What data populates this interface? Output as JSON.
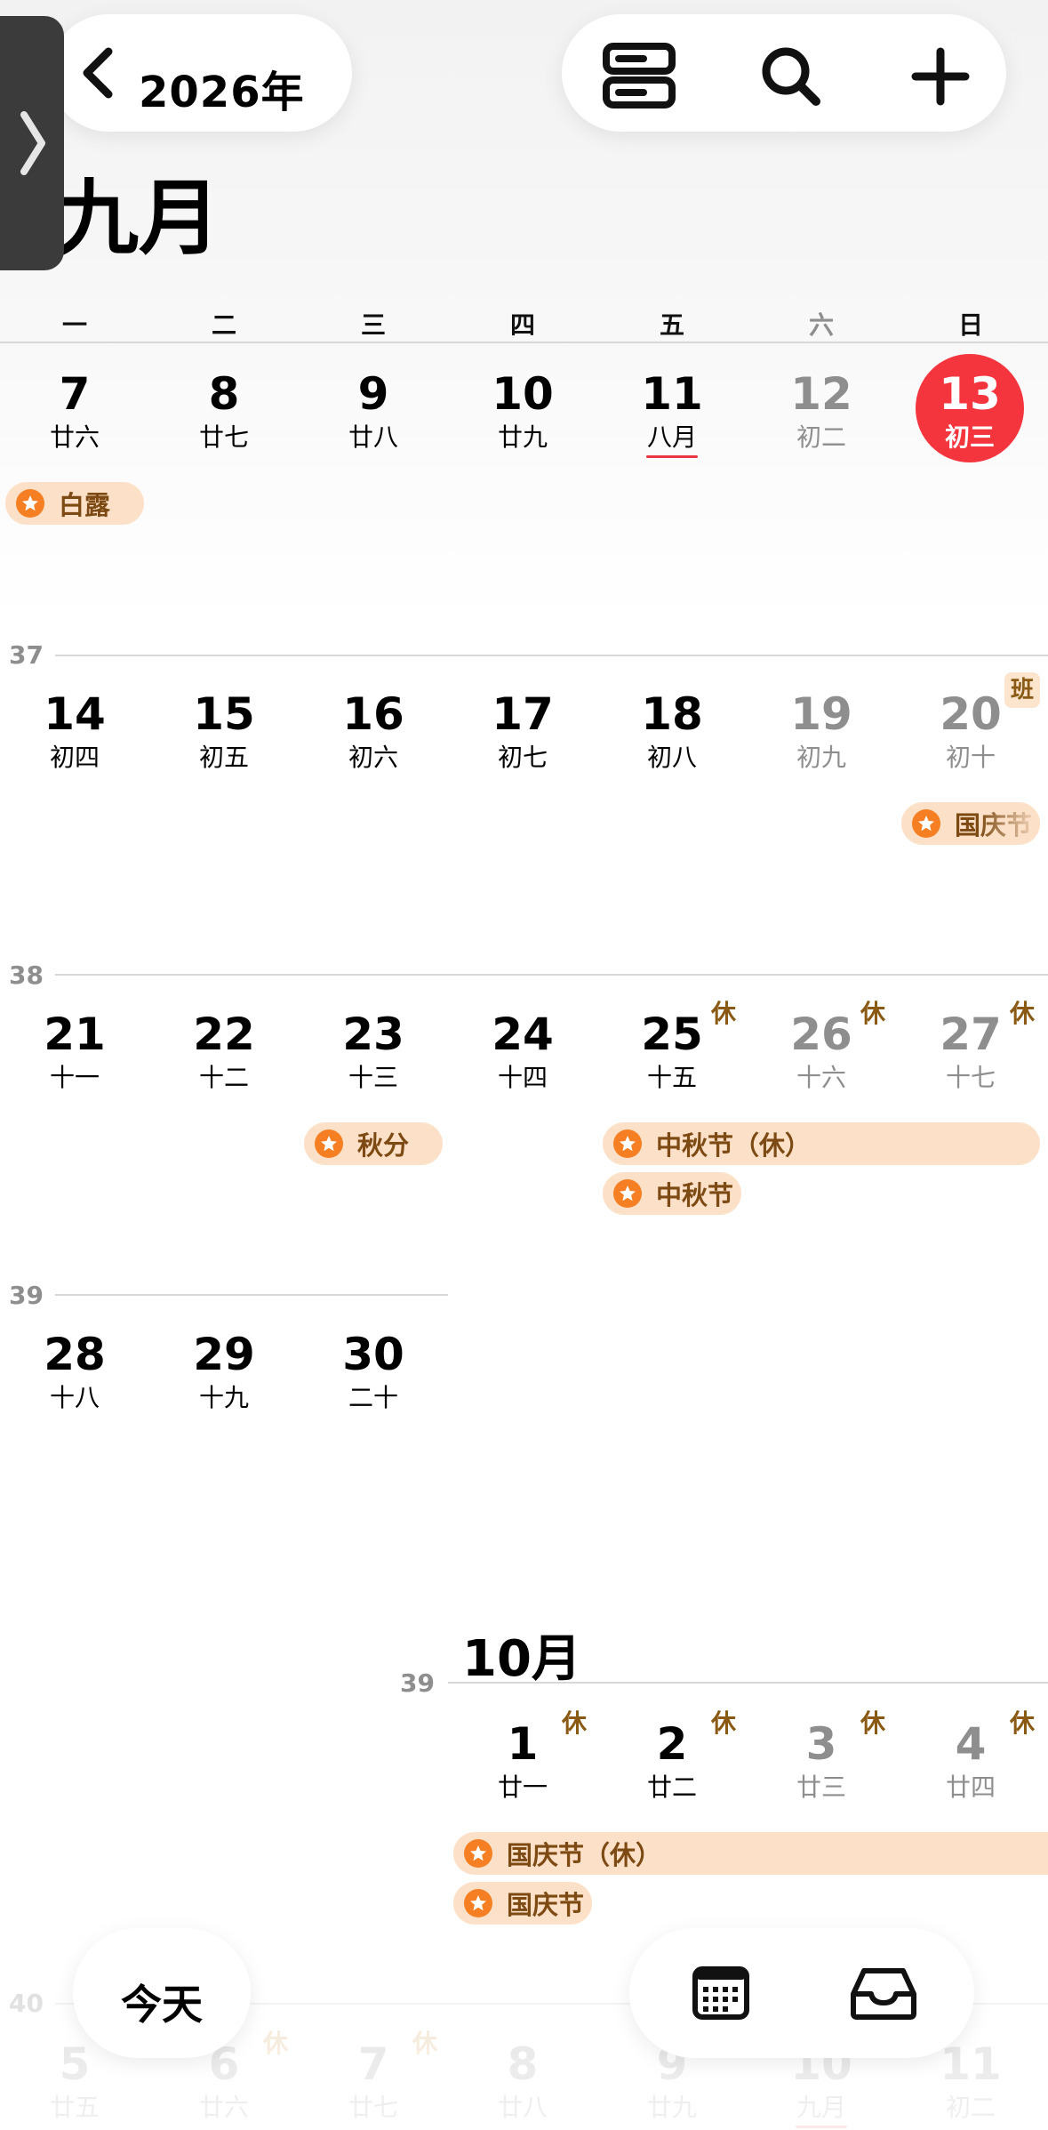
{
  "header": {
    "year": "2026年",
    "month_title": "九月"
  },
  "toolbar": {
    "icons": [
      "list-view-icon",
      "search-icon",
      "plus-icon"
    ]
  },
  "weekdays": [
    "一",
    "二",
    "三",
    "四",
    "五",
    "六",
    "日"
  ],
  "september": {
    "weeks": [
      {
        "days": [
          {
            "num": "7",
            "lunar": "廿六"
          },
          {
            "num": "8",
            "lunar": "廿七"
          },
          {
            "num": "9",
            "lunar": "廿八"
          },
          {
            "num": "10",
            "lunar": "廿九"
          },
          {
            "num": "11",
            "lunar": "八月"
          },
          {
            "num": "12",
            "lunar": "初二"
          },
          {
            "num": "13",
            "lunar": "初三"
          }
        ],
        "events": [
          {
            "label": "白露"
          }
        ]
      },
      {
        "week_number": "37",
        "days": [
          {
            "num": "14",
            "lunar": "初四"
          },
          {
            "num": "15",
            "lunar": "初五"
          },
          {
            "num": "16",
            "lunar": "初六"
          },
          {
            "num": "17",
            "lunar": "初七"
          },
          {
            "num": "18",
            "lunar": "初八"
          },
          {
            "num": "19",
            "lunar": "初九"
          },
          {
            "num": "20",
            "lunar": "初十",
            "badge": "班"
          }
        ],
        "events": [
          {
            "label": "国庆节"
          }
        ]
      },
      {
        "week_number": "38",
        "days": [
          {
            "num": "21",
            "lunar": "十一"
          },
          {
            "num": "22",
            "lunar": "十二"
          },
          {
            "num": "23",
            "lunar": "十三"
          },
          {
            "num": "24",
            "lunar": "十四"
          },
          {
            "num": "25",
            "lunar": "十五",
            "badge": "休"
          },
          {
            "num": "26",
            "lunar": "十六",
            "badge": "休"
          },
          {
            "num": "27",
            "lunar": "十七",
            "badge": "休"
          }
        ],
        "events": [
          {
            "label": "秋分"
          },
          {
            "label": "中秋节（休）"
          },
          {
            "label": "中秋节"
          }
        ]
      },
      {
        "week_number": "39",
        "days": [
          {
            "num": "28",
            "lunar": "十八"
          },
          {
            "num": "29",
            "lunar": "十九"
          },
          {
            "num": "30",
            "lunar": "二十"
          }
        ]
      }
    ]
  },
  "october": {
    "title": "10月",
    "weeks": [
      {
        "week_number": "39",
        "days": [
          {
            "num": "1",
            "lunar": "廿一",
            "badge": "休"
          },
          {
            "num": "2",
            "lunar": "廿二",
            "badge": "休"
          },
          {
            "num": "3",
            "lunar": "廿三",
            "badge": "休"
          },
          {
            "num": "4",
            "lunar": "廿四",
            "badge": "休"
          }
        ],
        "events": [
          {
            "label": "国庆节（休）"
          },
          {
            "label": "国庆节"
          }
        ]
      },
      {
        "week_number": "40",
        "days": [
          {
            "num": "5",
            "lunar": "廿五"
          },
          {
            "num": "6",
            "lunar": "廿六",
            "badge": "休"
          },
          {
            "num": "7",
            "lunar": "廿七",
            "badge": "休"
          },
          {
            "num": "8",
            "lunar": "廿八"
          },
          {
            "num": "9",
            "lunar": "廿九"
          },
          {
            "num": "10",
            "lunar": "九月"
          },
          {
            "num": "11",
            "lunar": "初二"
          }
        ]
      }
    ]
  },
  "bottom_bar": {
    "today_label": "今天",
    "icons": [
      "calendar-grid-icon",
      "inbox-icon"
    ]
  },
  "colors": {
    "today_circle": "#f5353e",
    "event_background": "#fde0c8",
    "event_star": "#f57f22",
    "event_text": "#7c4a12",
    "badge_text": "#8a5a14"
  }
}
